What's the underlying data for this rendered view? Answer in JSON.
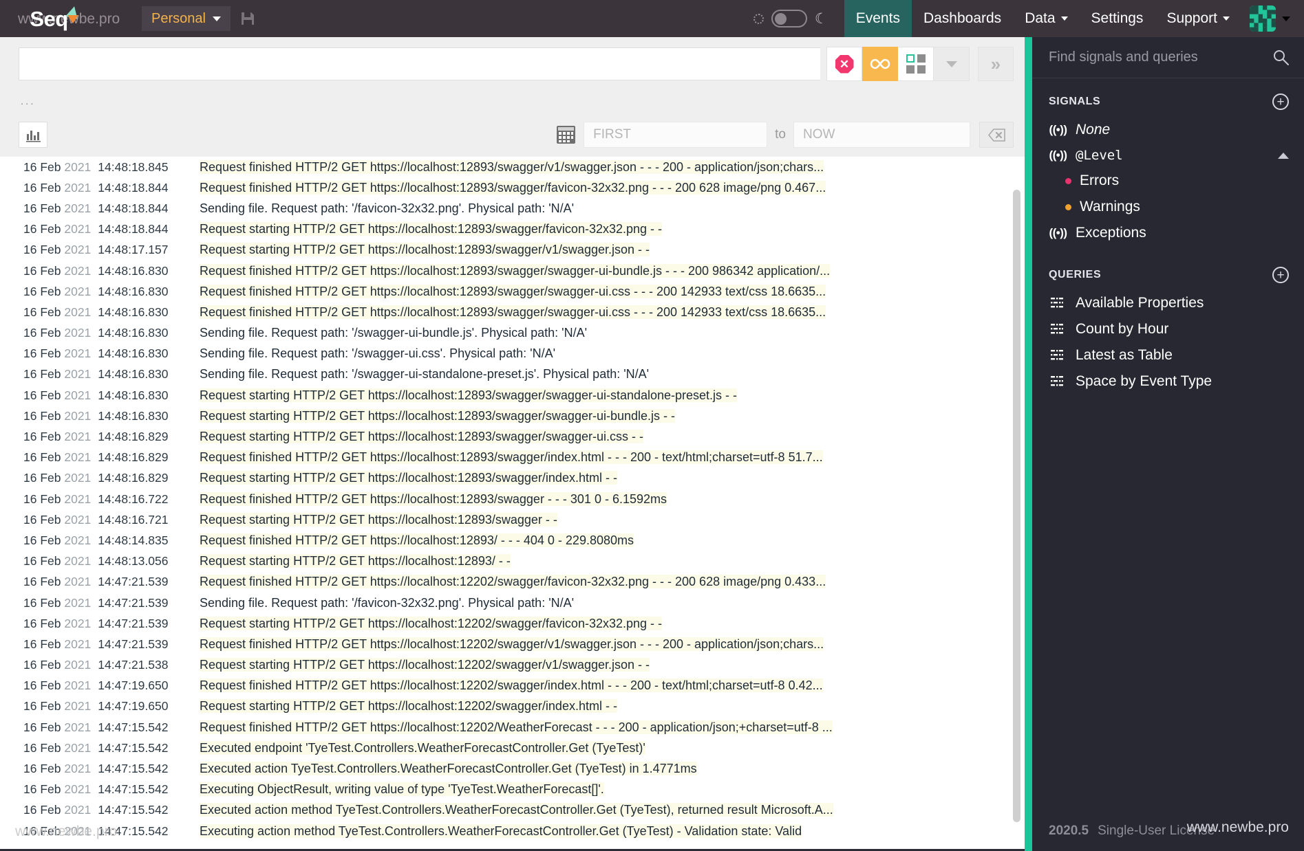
{
  "brand": {
    "name": "Seq",
    "watermark": "www.newbe.pro"
  },
  "topnav": {
    "workspace": {
      "label": "Personal",
      "chevron_icon": "chevron-down-icon"
    },
    "save_icon": "save-disk-icon",
    "theme": {
      "light_icon": "sun-icon",
      "dark_icon": "moon-icon",
      "state": "light"
    },
    "links": [
      {
        "label": "Events",
        "active": true,
        "has_chevron": false
      },
      {
        "label": "Dashboards",
        "active": false,
        "has_chevron": false
      },
      {
        "label": "Data",
        "active": false,
        "has_chevron": true
      },
      {
        "label": "Settings",
        "active": false,
        "has_chevron": false
      },
      {
        "label": "Support",
        "active": false,
        "has_chevron": true
      }
    ],
    "avatar": {
      "name": "user-avatar",
      "color": "#23c49a"
    }
  },
  "toolbar": {
    "search_value": "",
    "search_placeholder": "",
    "buttons": [
      {
        "name": "stop-button",
        "icon": "stop-octagon-icon",
        "state": "normal"
      },
      {
        "name": "follow-button",
        "icon": "infinity-icon",
        "state": "active"
      },
      {
        "name": "layout-button",
        "icon": "grid-layout-icon",
        "state": "normal"
      },
      {
        "name": "more-button",
        "icon": "chevron-down-icon",
        "state": "flat"
      },
      {
        "name": "expand-button",
        "icon": "double-chevron-right-icon",
        "state": "flat"
      }
    ],
    "ellipsis": "..."
  },
  "filters": {
    "chart_button_icon": "bar-chart-icon",
    "calendar_icon": "calendar-icon",
    "from_placeholder": "FIRST",
    "from_value": "",
    "to_label": "to",
    "to_placeholder": "NOW",
    "to_value": "",
    "clear_icon": "backspace-clear-icon"
  },
  "events": {
    "date_label": "16 Feb",
    "year_label": "2021",
    "rows": [
      {
        "time": "14:48:18.845",
        "message": "Request finished HTTP/2 GET https://localhost:12893/swagger/v1/swagger.json - - - 200 - application/json;chars...",
        "highlight": true
      },
      {
        "time": "14:48:18.844",
        "message": "Request finished HTTP/2 GET https://localhost:12893/swagger/favicon-32x32.png - - - 200 628 image/png 0.467...",
        "highlight": true
      },
      {
        "time": "14:48:18.844",
        "message": "Sending file. Request path: '/favicon-32x32.png'. Physical path: 'N/A'",
        "highlight": false
      },
      {
        "time": "14:48:18.844",
        "message": "Request starting HTTP/2 GET https://localhost:12893/swagger/favicon-32x32.png - -",
        "highlight": true
      },
      {
        "time": "14:48:17.157",
        "message": "Request starting HTTP/2 GET https://localhost:12893/swagger/v1/swagger.json - -",
        "highlight": true
      },
      {
        "time": "14:48:16.830",
        "message": "Request finished HTTP/2 GET https://localhost:12893/swagger/swagger-ui-bundle.js - - - 200 986342 application/...",
        "highlight": true
      },
      {
        "time": "14:48:16.830",
        "message": "Request finished HTTP/2 GET https://localhost:12893/swagger/swagger-ui.css - - - 200 142933 text/css 18.6635...",
        "highlight": true
      },
      {
        "time": "14:48:16.830",
        "message": "Request finished HTTP/2 GET https://localhost:12893/swagger/swagger-ui.css - - - 200 142933 text/css 18.6635...",
        "highlight": true
      },
      {
        "time": "14:48:16.830",
        "message": "Sending file. Request path: '/swagger-ui-bundle.js'. Physical path: 'N/A'",
        "highlight": false
      },
      {
        "time": "14:48:16.830",
        "message": "Sending file. Request path: '/swagger-ui.css'. Physical path: 'N/A'",
        "highlight": false
      },
      {
        "time": "14:48:16.830",
        "message": "Sending file. Request path: '/swagger-ui-standalone-preset.js'. Physical path: 'N/A'",
        "highlight": false
      },
      {
        "time": "14:48:16.830",
        "message": "Request starting HTTP/2 GET https://localhost:12893/swagger/swagger-ui-standalone-preset.js - -",
        "highlight": true
      },
      {
        "time": "14:48:16.830",
        "message": "Request starting HTTP/2 GET https://localhost:12893/swagger/swagger-ui-bundle.js - -",
        "highlight": true
      },
      {
        "time": "14:48:16.829",
        "message": "Request starting HTTP/2 GET https://localhost:12893/swagger/swagger-ui.css - -",
        "highlight": true
      },
      {
        "time": "14:48:16.829",
        "message": "Request finished HTTP/2 GET https://localhost:12893/swagger/index.html - - - 200 - text/html;charset=utf-8 51.7...",
        "highlight": true
      },
      {
        "time": "14:48:16.829",
        "message": "Request starting HTTP/2 GET https://localhost:12893/swagger/index.html - -",
        "highlight": true
      },
      {
        "time": "14:48:16.722",
        "message": "Request finished HTTP/2 GET https://localhost:12893/swagger - - - 301 0 - 6.1592ms",
        "highlight": true
      },
      {
        "time": "14:48:16.721",
        "message": "Request starting HTTP/2 GET https://localhost:12893/swagger - -",
        "highlight": true
      },
      {
        "time": "14:48:14.835",
        "message": "Request finished HTTP/2 GET https://localhost:12893/ - - - 404 0 - 229.8080ms",
        "highlight": true
      },
      {
        "time": "14:48:13.056",
        "message": "Request starting HTTP/2 GET https://localhost:12893/ - -",
        "highlight": true
      },
      {
        "time": "14:47:21.539",
        "message": "Request finished HTTP/2 GET https://localhost:12202/swagger/favicon-32x32.png - - - 200 628 image/png 0.433...",
        "highlight": true
      },
      {
        "time": "14:47:21.539",
        "message": "Sending file. Request path: '/favicon-32x32.png'. Physical path: 'N/A'",
        "highlight": false
      },
      {
        "time": "14:47:21.539",
        "message": "Request starting HTTP/2 GET https://localhost:12202/swagger/favicon-32x32.png - -",
        "highlight": true
      },
      {
        "time": "14:47:21.539",
        "message": "Request finished HTTP/2 GET https://localhost:12202/swagger/v1/swagger.json - - - 200 - application/json;chars...",
        "highlight": true
      },
      {
        "time": "14:47:21.538",
        "message": "Request starting HTTP/2 GET https://localhost:12202/swagger/v1/swagger.json - -",
        "highlight": true
      },
      {
        "time": "14:47:19.650",
        "message": "Request finished HTTP/2 GET https://localhost:12202/swagger/index.html - - - 200 - text/html;charset=utf-8 0.42...",
        "highlight": true
      },
      {
        "time": "14:47:19.650",
        "message": "Request starting HTTP/2 GET https://localhost:12202/swagger/index.html - -",
        "highlight": true
      },
      {
        "time": "14:47:15.542",
        "message": "Request finished HTTP/2 GET https://localhost:12202/WeatherForecast - - - 200 - application/json;+charset=utf-8 ...",
        "highlight": true
      },
      {
        "time": "14:47:15.542",
        "message": "Executed endpoint 'TyeTest.Controllers.WeatherForecastController.Get (TyeTest)'",
        "highlight": true
      },
      {
        "time": "14:47:15.542",
        "message": "Executed action TyeTest.Controllers.WeatherForecastController.Get (TyeTest) in 1.4771ms",
        "highlight": true
      },
      {
        "time": "14:47:15.542",
        "message": "Executing ObjectResult, writing value of type 'TyeTest.WeatherForecast[]'.",
        "highlight": true
      },
      {
        "time": "14:47:15.542",
        "message": "Executed action method TyeTest.Controllers.WeatherForecastController.Get (TyeTest), returned result Microsoft.A...",
        "highlight": true
      },
      {
        "time": "14:47:15.542",
        "message": "Executing action method TyeTest.Controllers.WeatherForecastController.Get (TyeTest) - Validation state: Valid",
        "highlight": true
      }
    ],
    "watermark": "www.newbe.pro"
  },
  "sidebar": {
    "search_placeholder": "Find signals and queries",
    "search_icon": "search-icon",
    "signals": {
      "title": "SIGNALS",
      "add_icon": "plus-circle-icon",
      "items": [
        {
          "label": "None",
          "icon": "signal-icon",
          "style": "italic",
          "indent": false,
          "collapse_icon": null
        },
        {
          "label": "@Level",
          "icon": "signal-icon",
          "style": "mono",
          "indent": false,
          "collapse_icon": "chevron-up-icon"
        },
        {
          "label": "Errors",
          "icon": "dot",
          "dot_color": "#e8336d",
          "indent": true
        },
        {
          "label": "Warnings",
          "icon": "dot",
          "dot_color": "#f0a22e",
          "indent": true
        },
        {
          "label": "Exceptions",
          "icon": "signal-icon",
          "style": "normal",
          "indent": false,
          "collapse_icon": null
        }
      ]
    },
    "queries": {
      "title": "QUERIES",
      "add_icon": "plus-circle-icon",
      "items": [
        {
          "label": "Available Properties",
          "icon": "query-grid-icon"
        },
        {
          "label": "Count by Hour",
          "icon": "query-grid-icon"
        },
        {
          "label": "Latest as Table",
          "icon": "query-grid-icon"
        },
        {
          "label": "Space by Event Type",
          "icon": "query-grid-icon"
        }
      ]
    },
    "footer": {
      "version": "2020.5",
      "license": "Single-User License"
    },
    "watermark": "www.newbe.pro"
  }
}
